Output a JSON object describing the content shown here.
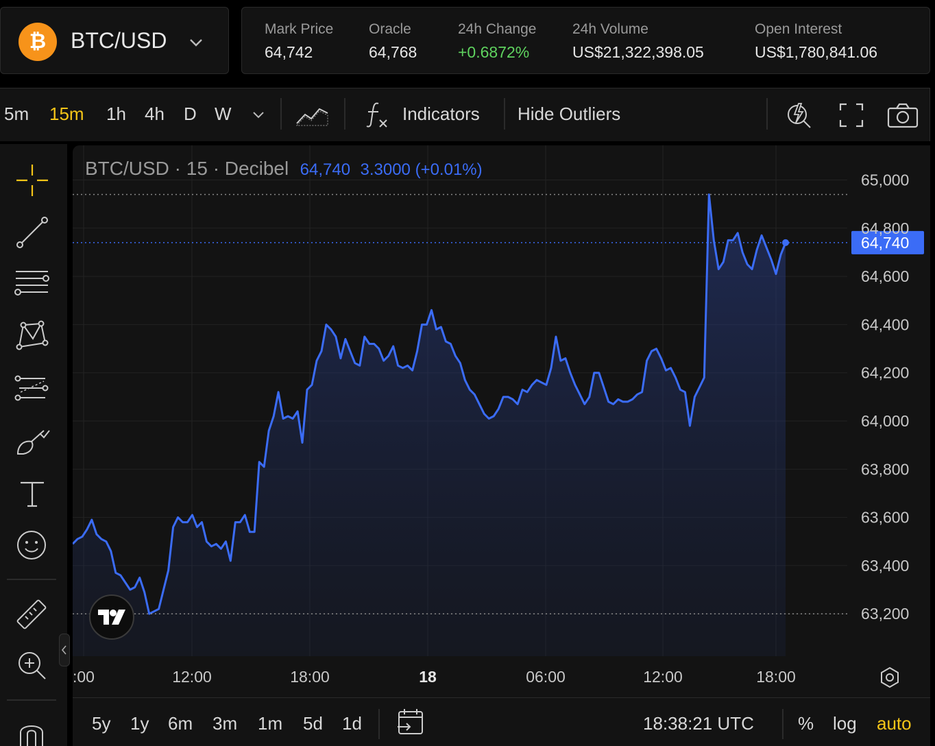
{
  "market": {
    "symbol": "BTC/USD",
    "coin_glyph": "₿",
    "coin_color": "#f7931a"
  },
  "stats": [
    {
      "label": "Mark Price",
      "value": "64,742",
      "color": "#e6e6e6"
    },
    {
      "label": "Oracle",
      "value": "64,768",
      "color": "#e6e6e6"
    },
    {
      "label": "24h Change",
      "value": "+0.6872%",
      "color": "#5fd35f"
    },
    {
      "label": "24h Volume",
      "value": "US$21,322,398.05",
      "color": "#e6e6e6"
    },
    {
      "label": "Open Interest",
      "value": "US$1,780,841.06",
      "color": "#e6e6e6"
    }
  ],
  "toolbar": {
    "timeframes": [
      "5m",
      "15m",
      "1h",
      "4h",
      "D",
      "W"
    ],
    "active_timeframe": "15m",
    "indicators_label": "Indicators",
    "hide_outliers_label": "Hide Outliers",
    "active_color": "#f5c518"
  },
  "legend": {
    "title": "BTC/USD · 15 · Decibel",
    "last": "64,740",
    "change": "3.3000 (+0.01%)",
    "color": "#3b6cf6"
  },
  "chart_data": {
    "type": "area",
    "y_ticks": [
      "65,000",
      "64,800",
      "64,600",
      "64,400",
      "64,200",
      "64,000",
      "63,800",
      "63,600",
      "63,400",
      "63,200"
    ],
    "x_ticks": [
      ":00",
      "12:00",
      "18:00",
      "18",
      "06:00",
      "12:00",
      "18:00"
    ],
    "ylim": [
      63000,
      65200
    ],
    "last_price_label": "64,740",
    "line_color": "#3b6cf6",
    "series_prices": [
      63490,
      63510,
      63520,
      63550,
      63590,
      63530,
      63510,
      63500,
      63460,
      63370,
      63360,
      63330,
      63300,
      63310,
      63350,
      63290,
      63200,
      63210,
      63220,
      63300,
      63380,
      63560,
      63600,
      63580,
      63580,
      63610,
      63560,
      63580,
      63500,
      63480,
      63490,
      63470,
      63500,
      63420,
      63580,
      63580,
      63610,
      63540,
      63540,
      63830,
      63810,
      63960,
      64020,
      64120,
      64010,
      64020,
      64010,
      64040,
      63910,
      64130,
      64150,
      64250,
      64290,
      64400,
      64380,
      64350,
      64260,
      64340,
      64290,
      64240,
      64230,
      64350,
      64320,
      64320,
      64300,
      64250,
      64270,
      64310,
      64230,
      64220,
      64230,
      64210,
      64290,
      64400,
      64400,
      64460,
      64380,
      64390,
      64330,
      64320,
      64270,
      64240,
      64170,
      64130,
      64110,
      64070,
      64030,
      64010,
      64020,
      64050,
      64100,
      64100,
      64090,
      64070,
      64130,
      64120,
      64150,
      64170,
      64160,
      64150,
      64220,
      64350,
      64250,
      64260,
      64200,
      64150,
      64110,
      64070,
      64100,
      64200,
      64200,
      64140,
      64080,
      64070,
      64090,
      64080,
      64080,
      64090,
      64110,
      64120,
      64250,
      64290,
      64300,
      64260,
      64210,
      64220,
      64180,
      64130,
      64120,
      63980,
      64100,
      64140,
      64180,
      64940,
      64750,
      64630,
      64660,
      64750,
      64750,
      64780,
      64700,
      64650,
      64630,
      64710,
      64770,
      64720,
      64670,
      64610,
      64690,
      64740
    ],
    "grid": true
  },
  "bottom": {
    "ranges": [
      "5y",
      "1y",
      "6m",
      "3m",
      "1m",
      "5d",
      "1d"
    ],
    "time": "18:38:21 UTC",
    "percent_label": "%",
    "log_label": "log",
    "auto_label": "auto"
  }
}
